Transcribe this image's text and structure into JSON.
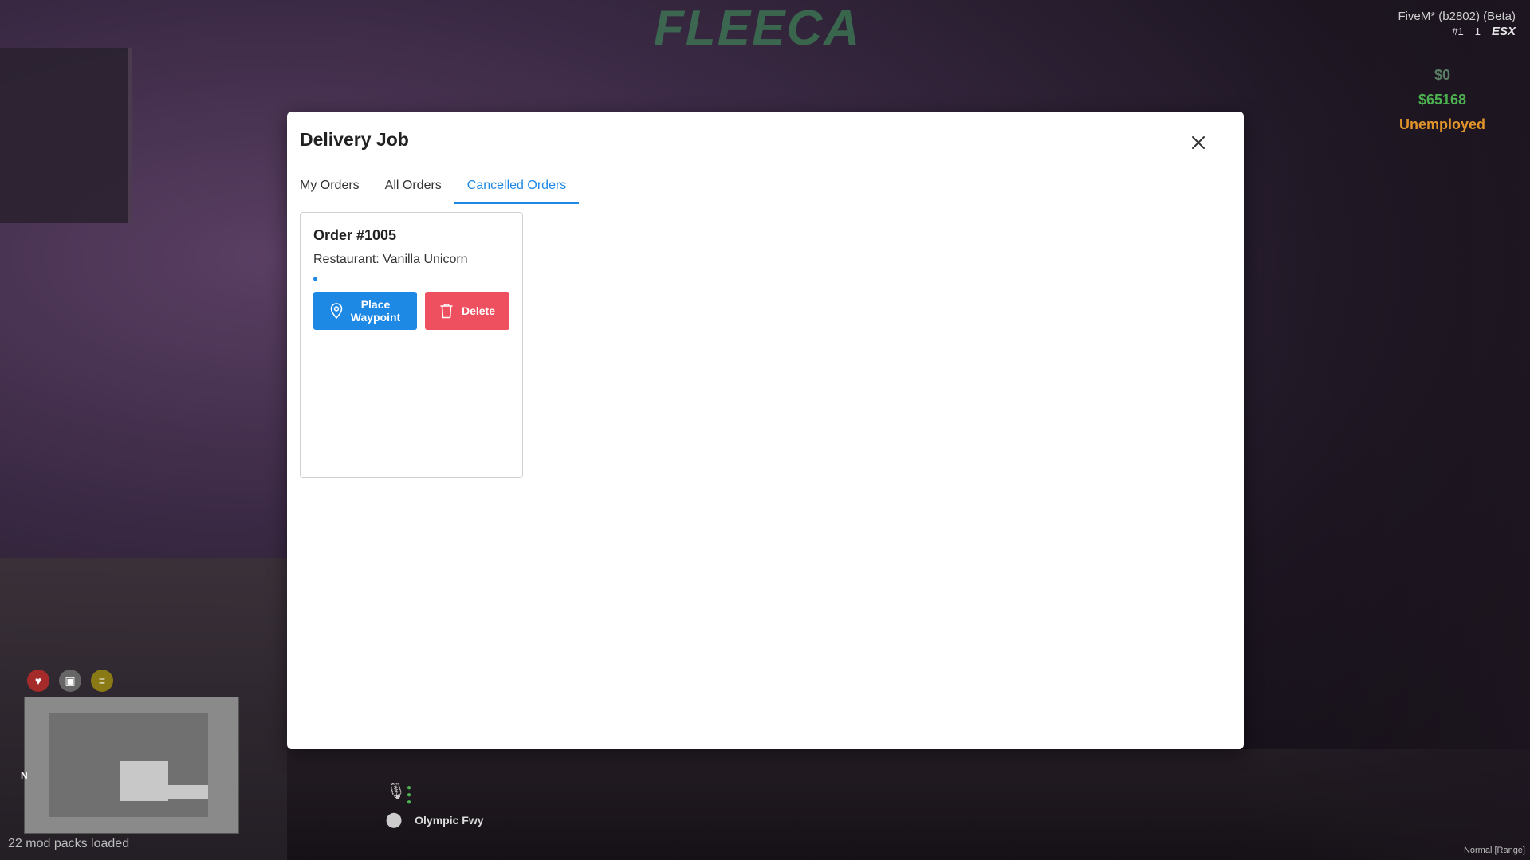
{
  "background": {
    "sign_text": "FLEECA"
  },
  "hud": {
    "client_title": "FiveM* (b2802) (Beta)",
    "player_id": "#1",
    "player_count": "1",
    "framework": "ESX",
    "cash": "$0",
    "bank": "$65168",
    "job": "Unemployed",
    "mods_loaded": "22 mod packs loaded",
    "street": "Olympic Fwy",
    "compass": "N",
    "voice_mode": "Normal [Range]",
    "colors": {
      "cash": "#5a7d66",
      "bank": "#4caf50",
      "job": "#e0932a"
    }
  },
  "modal": {
    "title": "Delivery Job",
    "tabs": [
      {
        "label": "My Orders",
        "active": false
      },
      {
        "label": "All Orders",
        "active": false
      },
      {
        "label": "Cancelled Orders",
        "active": true
      }
    ],
    "orders": [
      {
        "title": "Order #1005",
        "restaurant": "Restaurant: Vanilla Unicorn",
        "progress": 0.02,
        "waypoint_label_line1": "Place",
        "waypoint_label_line2": "Waypoint",
        "delete_label": "Delete"
      }
    ],
    "icons": {
      "close": "close-icon",
      "waypoint": "map-pin-icon",
      "delete": "trash-icon"
    },
    "colors": {
      "accent": "#1e88e5",
      "danger": "#ef5060"
    }
  }
}
